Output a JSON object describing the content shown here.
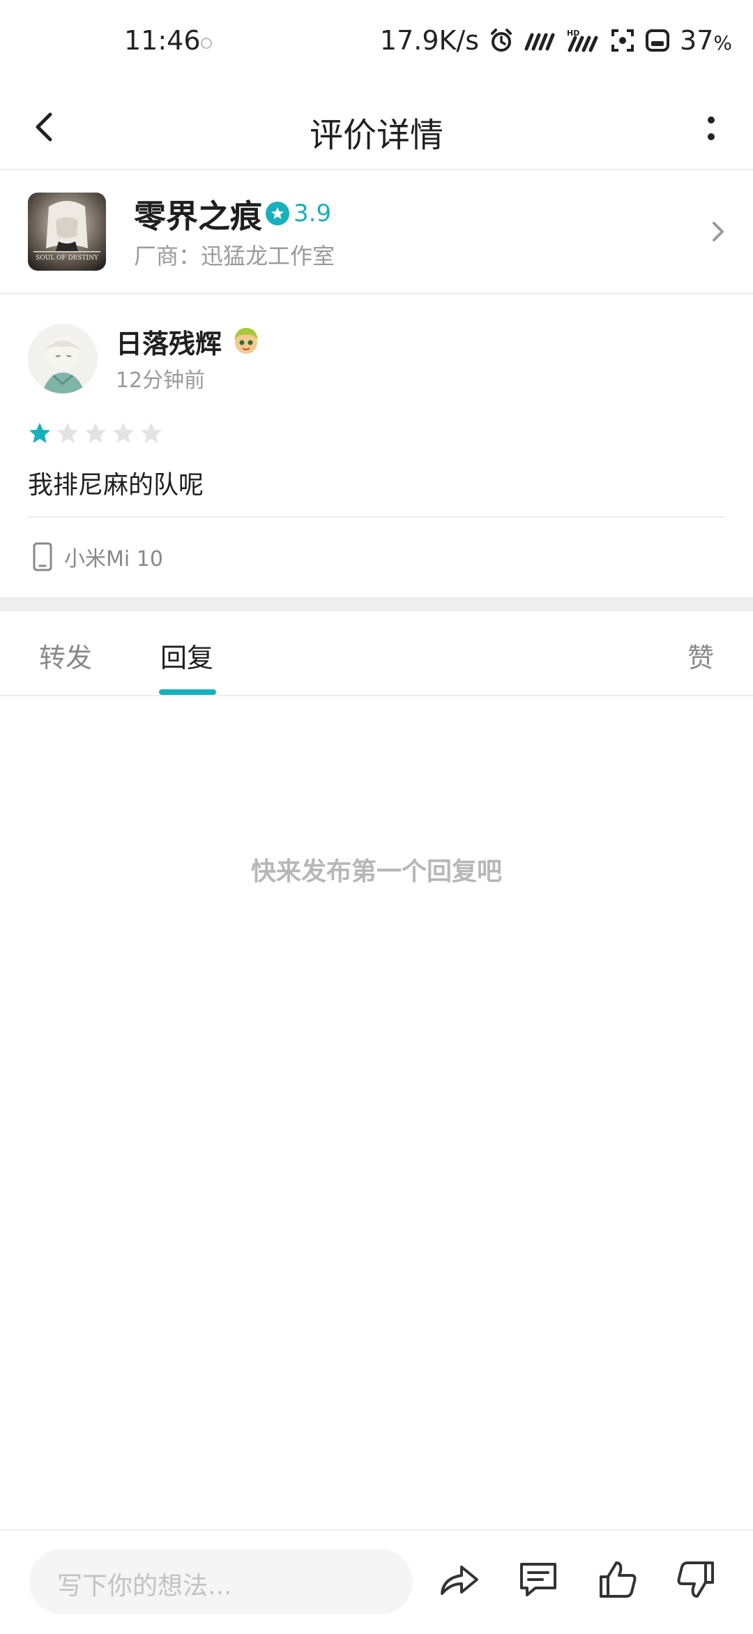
{
  "status_bar": {
    "time": "11:46",
    "net_speed": "17.9K/s",
    "battery_pct": "37",
    "pct_sign": "%"
  },
  "nav": {
    "title": "评价详情"
  },
  "game": {
    "name": "零界之痕",
    "rating": "3.9",
    "vendor": "厂商：迅猛龙工作室",
    "icon_text": "SOUL OF DESTINY"
  },
  "review": {
    "username": "日落残辉",
    "time_ago": "12分钟前",
    "stars_filled": 1,
    "stars_total": 5,
    "text": "我排尼麻的队呢",
    "device": "小米Mi 10"
  },
  "tabs": [
    {
      "label": "转发",
      "active": false
    },
    {
      "label": "回复",
      "active": true
    },
    {
      "label": "赞",
      "active": false
    }
  ],
  "empty_state": "快来发布第一个回复吧",
  "composer": {
    "placeholder": "写下你的想法..."
  },
  "colors": {
    "accent": "#17b0bd",
    "star_empty": "#e3e3e3"
  },
  "icons": [
    "back-icon",
    "more-icon",
    "star-badge-icon",
    "chevron-right-icon",
    "phone-icon",
    "share-icon",
    "comment-icon",
    "thumbs-up-icon",
    "thumbs-down-icon"
  ]
}
